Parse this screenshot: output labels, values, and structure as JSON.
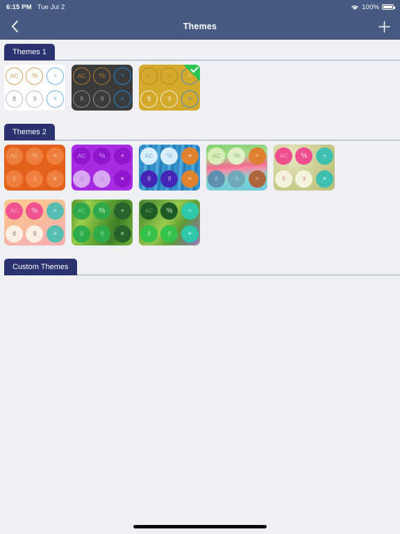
{
  "status_bar": {
    "time": "6:15 PM",
    "date": "Tue Jul 2",
    "wifi_icon": "wifi-icon",
    "battery_percent": "100%",
    "battery_icon": "battery-icon"
  },
  "nav_bar": {
    "back_icon": "chevron-left-icon",
    "title": "Themes",
    "add_icon": "plus-icon"
  },
  "keys": {
    "ac": "AC",
    "percent": "%",
    "divide": "÷",
    "eight": "8",
    "nine": "9",
    "multiply": "×"
  },
  "colors": {
    "nav_background": "#465a84",
    "section_tab": "#2b3270",
    "page_background": "#eef0f3",
    "selected_check": "#29c551",
    "separator": "#9aa3bd"
  },
  "sections": [
    {
      "title": "Themes 1",
      "themes": [
        {
          "name": "theme-light",
          "selected": false
        },
        {
          "name": "theme-dark",
          "selected": false
        },
        {
          "name": "theme-gold",
          "selected": true
        }
      ]
    },
    {
      "title": "Themes 2",
      "themes": [
        {
          "name": "theme-orange",
          "selected": false
        },
        {
          "name": "theme-purple",
          "selected": false
        },
        {
          "name": "theme-blue-water",
          "selected": false
        },
        {
          "name": "theme-rainbow-gradient",
          "selected": false
        },
        {
          "name": "theme-khaki-pink",
          "selected": false
        },
        {
          "name": "theme-peach-pink",
          "selected": false
        },
        {
          "name": "theme-green-leaf",
          "selected": false
        },
        {
          "name": "theme-green-stem",
          "selected": false
        }
      ]
    },
    {
      "title": "Custom Themes",
      "themes": []
    }
  ],
  "home_indicator": "home-indicator"
}
